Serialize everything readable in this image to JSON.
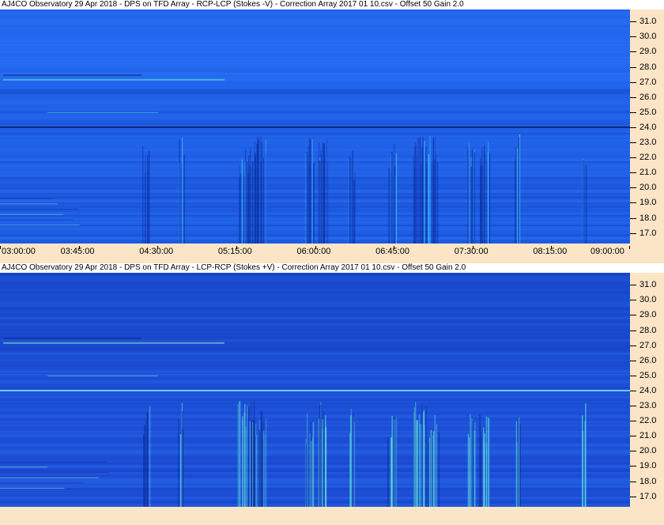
{
  "chart_data": [
    {
      "type": "heatmap",
      "title": "AJ4CO Observatory 29 Apr 2018  -  DPS on TFD Array  -  RCP-LCP (Stokes -V)  -  Correction Array 2017 01 10.csv  -  Offset 50  Gain 2.0",
      "x_ticks": [
        "03:00:00",
        "03:45:00",
        "04:30:00",
        "05:15:00",
        "06:00:00",
        "06:45:00",
        "07:30:00",
        "08:15:00",
        "09:00:00"
      ],
      "y_ticks": [
        "31.0",
        "30.0",
        "29.0",
        "28.0",
        "27.0",
        "26.0",
        "25.0",
        "24.0",
        "23.0",
        "22.0",
        "21.0",
        "20.0",
        "19.0",
        "18.0",
        "17.0"
      ],
      "xlim": [
        "03:00:00",
        "09:00:00"
      ],
      "ylim": [
        16.3,
        31.8
      ],
      "colors": {
        "base": "#1f5fe6",
        "dark": "#0a2a9a",
        "bright": "#3fd0ff"
      }
    },
    {
      "type": "heatmap",
      "title": "AJ4CO Observatory 29 Apr 2018  -  DPS on TFD Array  -  LCP-RCP (Stokes +V)  -  Correction Array 2017 01 10.csv  -  Offset 50  Gain 2.0",
      "x_ticks": [],
      "y_ticks": [
        "31.0",
        "30.0",
        "29.0",
        "28.0",
        "27.0",
        "26.0",
        "25.0",
        "24.0",
        "23.0",
        "22.0",
        "21.0",
        "20.0",
        "19.0",
        "18.0",
        "17.0"
      ],
      "xlim": [
        "03:00:00",
        "09:00:00"
      ],
      "ylim": [
        16.3,
        31.8
      ],
      "colors": {
        "base": "#1d50d8",
        "dark": "#0a2a9a",
        "bright": "#5fe6d8"
      }
    }
  ]
}
